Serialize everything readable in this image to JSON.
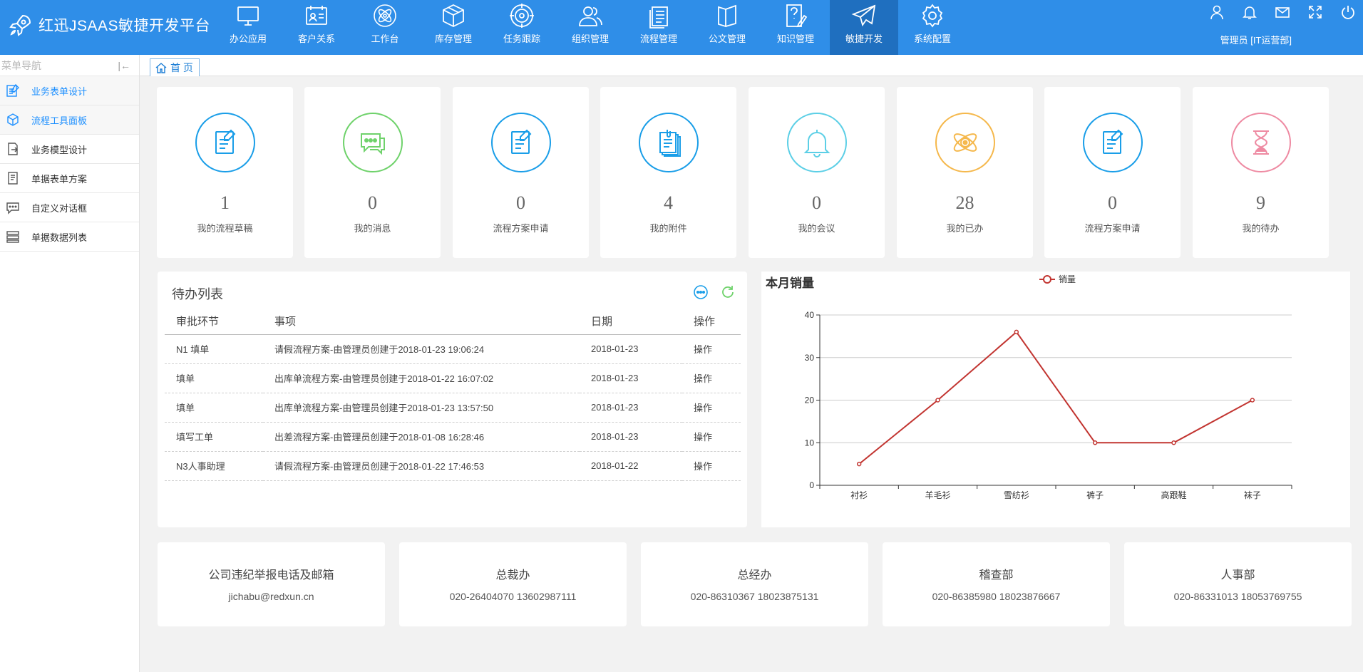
{
  "header": {
    "title": "红迅JSAAS敏捷开发平台",
    "nav": [
      {
        "label": "办公应用",
        "icon": "monitor-icon"
      },
      {
        "label": "客户关系",
        "icon": "id-card-icon"
      },
      {
        "label": "工作台",
        "icon": "atom-icon"
      },
      {
        "label": "库存管理",
        "icon": "box-icon"
      },
      {
        "label": "任务跟踪",
        "icon": "target-icon"
      },
      {
        "label": "组织管理",
        "icon": "users-icon"
      },
      {
        "label": "流程管理",
        "icon": "list-doc-icon"
      },
      {
        "label": "公文管理",
        "icon": "book-icon"
      },
      {
        "label": "知识管理",
        "icon": "question-doc-icon"
      },
      {
        "label": "敏捷开发",
        "icon": "paper-plane-icon"
      },
      {
        "label": "系统配置",
        "icon": "gear-icon"
      }
    ],
    "active_nav": "敏捷开发",
    "user": "管理员 [IT运营部]"
  },
  "sidebar": {
    "title": "菜单导航",
    "items": [
      {
        "label": "业务表单设计",
        "icon": "form-edit-icon"
      },
      {
        "label": "流程工具面板",
        "icon": "cube-icon"
      },
      {
        "label": "业务模型设计",
        "icon": "doc-export-icon"
      },
      {
        "label": "单据表单方案",
        "icon": "doc-list-icon"
      },
      {
        "label": "自定义对话框",
        "icon": "chat-bubble-icon"
      },
      {
        "label": "单据数据列表",
        "icon": "data-list-icon"
      }
    ]
  },
  "tabs": {
    "home": "首 页"
  },
  "stats": [
    {
      "value": "1",
      "label": "我的流程草稿",
      "color": "#1a9ee8",
      "icon": "edit-doc-icon"
    },
    {
      "value": "0",
      "label": "我的消息",
      "color": "#6fd26b",
      "icon": "message-icon"
    },
    {
      "value": "0",
      "label": "流程方案申请",
      "color": "#1a9ee8",
      "icon": "edit-doc-icon"
    },
    {
      "value": "4",
      "label": "我的附件",
      "color": "#1a9ee8",
      "icon": "attachment-icon"
    },
    {
      "value": "0",
      "label": "我的会议",
      "color": "#5ccfe6",
      "icon": "bell-icon"
    },
    {
      "value": "28",
      "label": "我的已办",
      "color": "#f5b84c",
      "icon": "atom-icon"
    },
    {
      "value": "0",
      "label": "流程方案申请",
      "color": "#1a9ee8",
      "icon": "edit-doc-icon"
    },
    {
      "value": "9",
      "label": "我的待办",
      "color": "#ee8aa2",
      "icon": "hourglass-icon"
    }
  ],
  "todo": {
    "title": "待办列表",
    "columns": [
      "审批环节",
      "事项",
      "日期",
      "操作"
    ],
    "rows": [
      [
        "N1 填单",
        "请假流程方案-由管理员创建于2018-01-23 19:06:24",
        "2018-01-23",
        "操作"
      ],
      [
        "填单",
        "出库单流程方案-由管理员创建于2018-01-22 16:07:02",
        "2018-01-23",
        "操作"
      ],
      [
        "填单",
        "出库单流程方案-由管理员创建于2018-01-23 13:57:50",
        "2018-01-23",
        "操作"
      ],
      [
        "填写工单",
        "出差流程方案-由管理员创建于2018-01-08 16:28:46",
        "2018-01-23",
        "操作"
      ],
      [
        "N3人事助理",
        "请假流程方案-由管理员创建于2018-01-22 17:46:53",
        "2018-01-22",
        "操作"
      ]
    ]
  },
  "chart_data": {
    "type": "line",
    "title": "本月销量",
    "categories": [
      "衬衫",
      "羊毛衫",
      "雪纺衫",
      "裤子",
      "高跟鞋",
      "袜子"
    ],
    "series": [
      {
        "name": "销量",
        "values": [
          5,
          20,
          36,
          10,
          10,
          20
        ]
      }
    ],
    "ylim": [
      0,
      40
    ],
    "yticks": [
      0,
      10,
      20,
      30,
      40
    ],
    "legend": "top-center",
    "grid": true,
    "line_color": "#c23531"
  },
  "contacts": [
    {
      "title": "公司违纪举报电话及邮箱",
      "value": "jichabu@redxun.cn"
    },
    {
      "title": "总裁办",
      "value": "020-26404070 13602987111"
    },
    {
      "title": "总经办",
      "value": "020-86310367 18023875131"
    },
    {
      "title": "稽查部",
      "value": "020-86385980 18023876667"
    },
    {
      "title": "人事部",
      "value": "020-86331013 18053769755"
    }
  ]
}
